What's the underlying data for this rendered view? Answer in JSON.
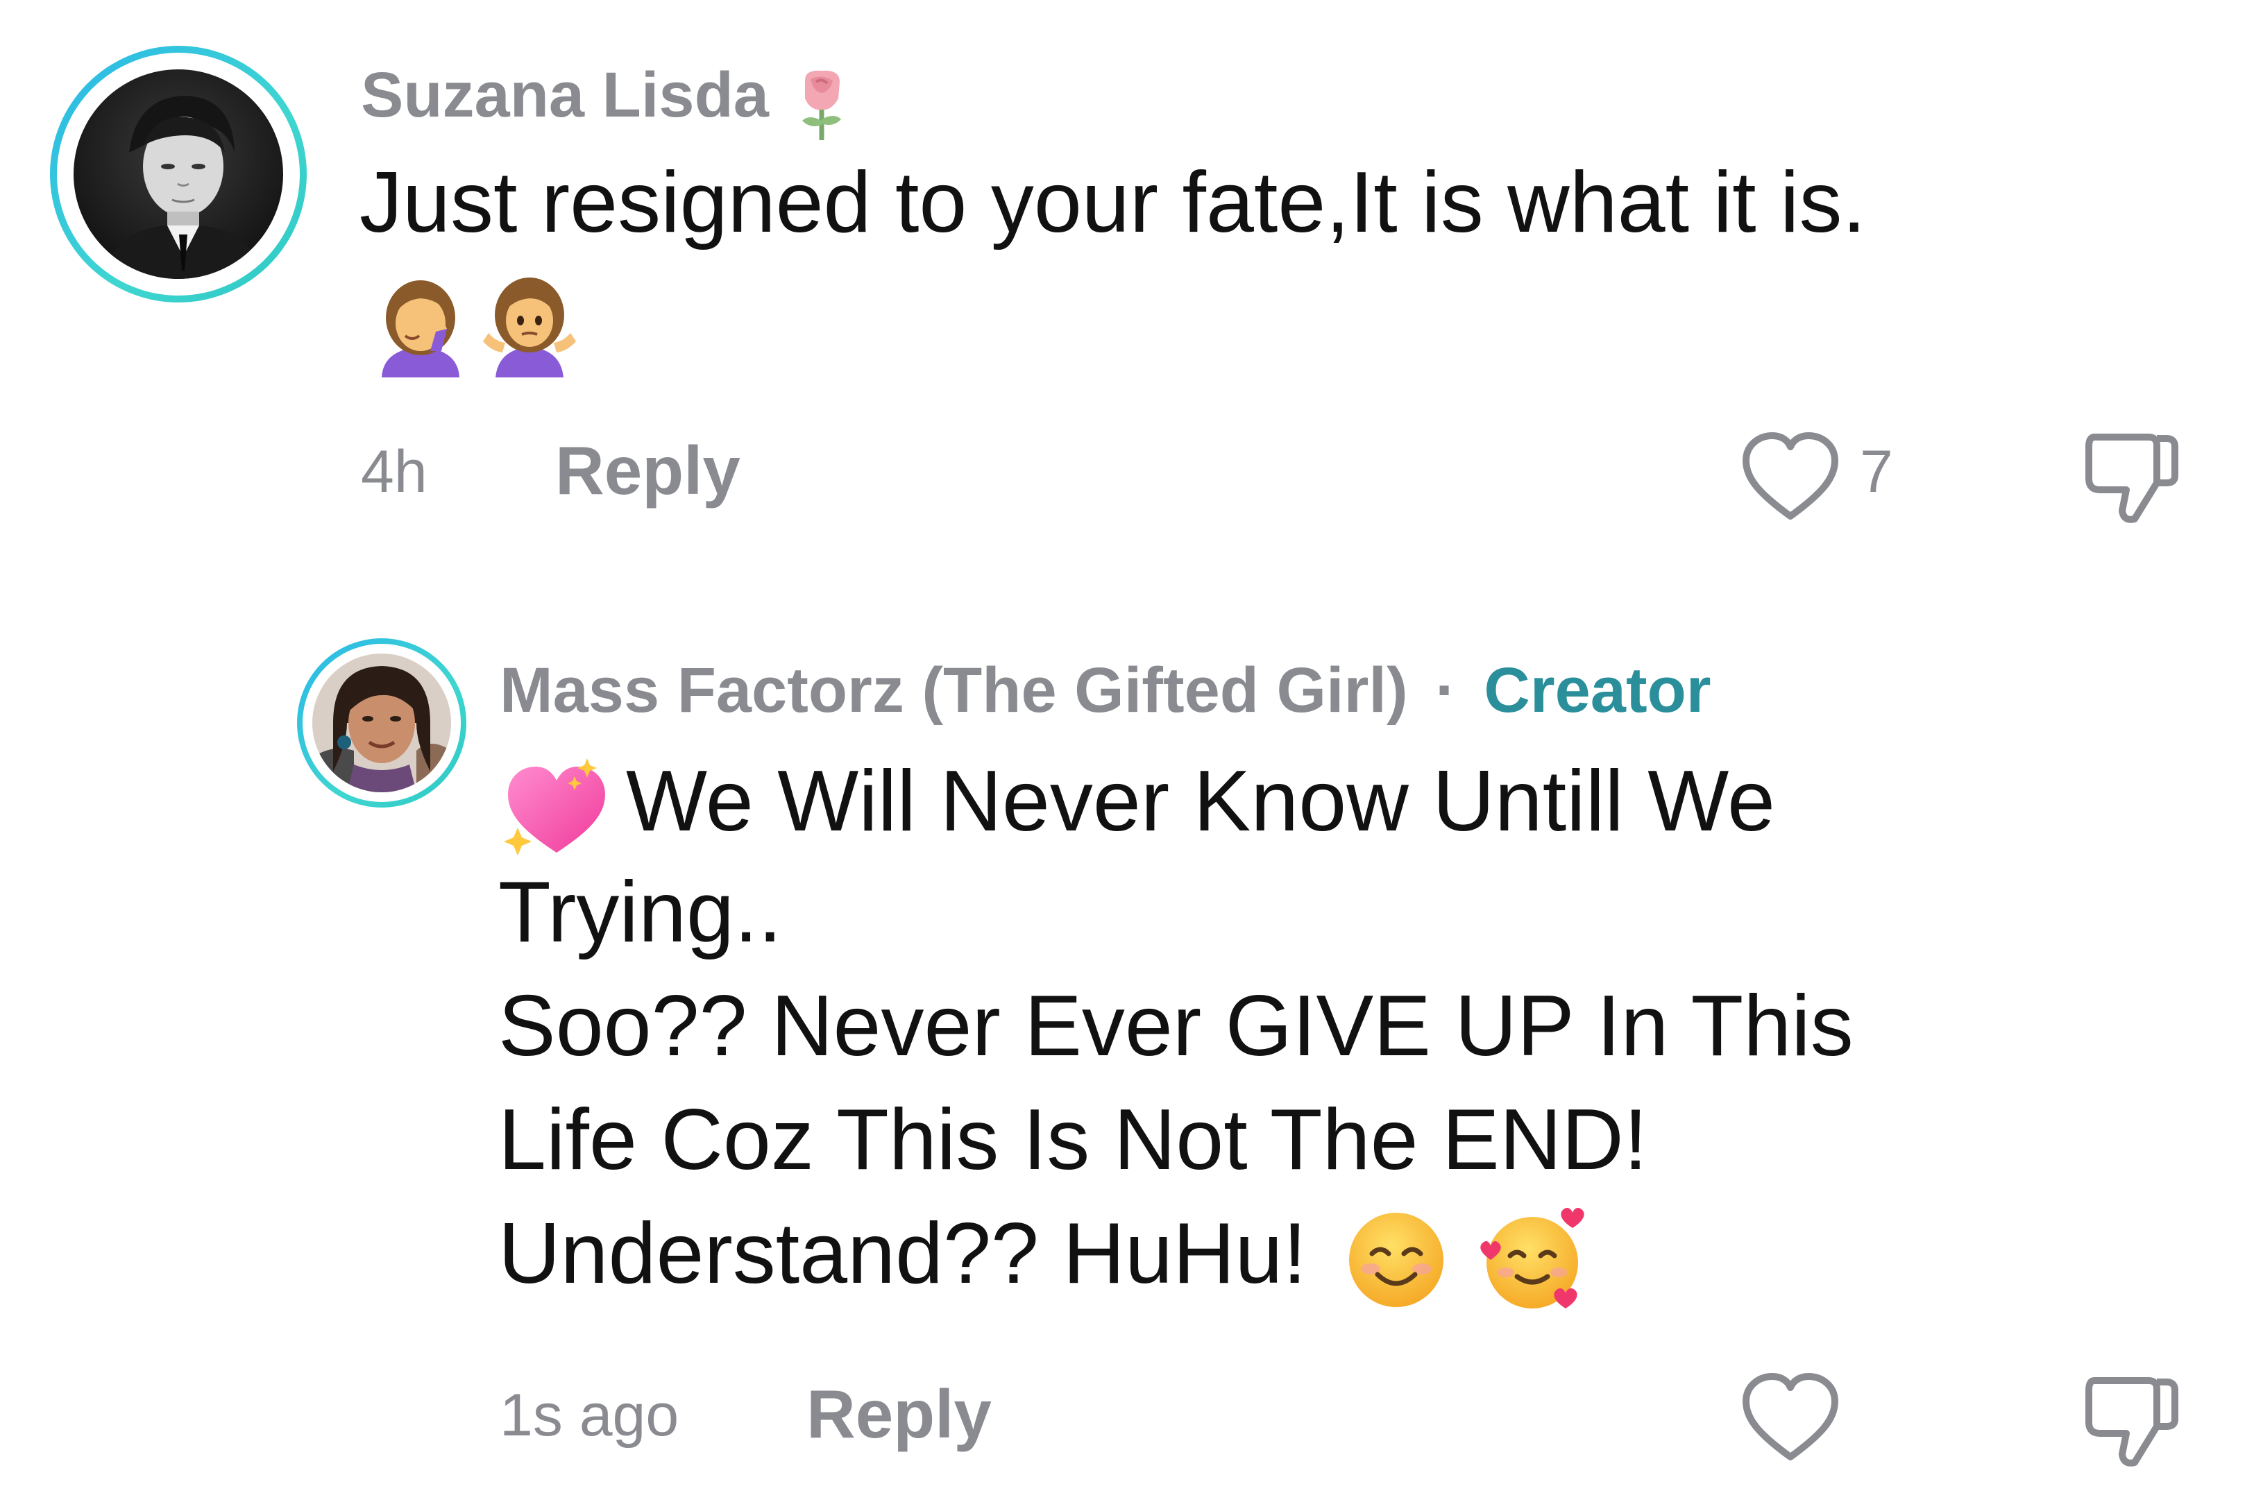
{
  "comments": [
    {
      "username": "Suzana Lisda",
      "username_badge_icon": "rose-emoji",
      "text_line1": "Just resigned to your fate,It is what it is.",
      "text_emojis": [
        "woman-facepalming-emoji",
        "woman-shrugging-emoji"
      ],
      "time": "4h",
      "reply_label": "Reply",
      "like_count": "7",
      "avatar": "profile-photo-grayscale-man"
    },
    {
      "username": "Mass Factorz (The Gifted Girl)",
      "separator": "·",
      "creator_label": "Creator",
      "lead_emoji": "sparkling-heart-emoji",
      "text_lines": [
        "We Will Never Know Untill We",
        "Trying..",
        "Soo?? Never Ever GIVE UP In This",
        "Life Coz This Is Not The END!",
        "Understand?? HuHu!"
      ],
      "trailing_emojis": [
        "smiling-face-emoji",
        "smiling-face-with-hearts-emoji"
      ],
      "time": "1s ago",
      "reply_label": "Reply",
      "avatar": "profile-photo-woman"
    }
  ],
  "colors": {
    "username": "#8a8b91",
    "text": "#111111",
    "creator": "#2a8f9b",
    "icon": "#8a8b91"
  }
}
